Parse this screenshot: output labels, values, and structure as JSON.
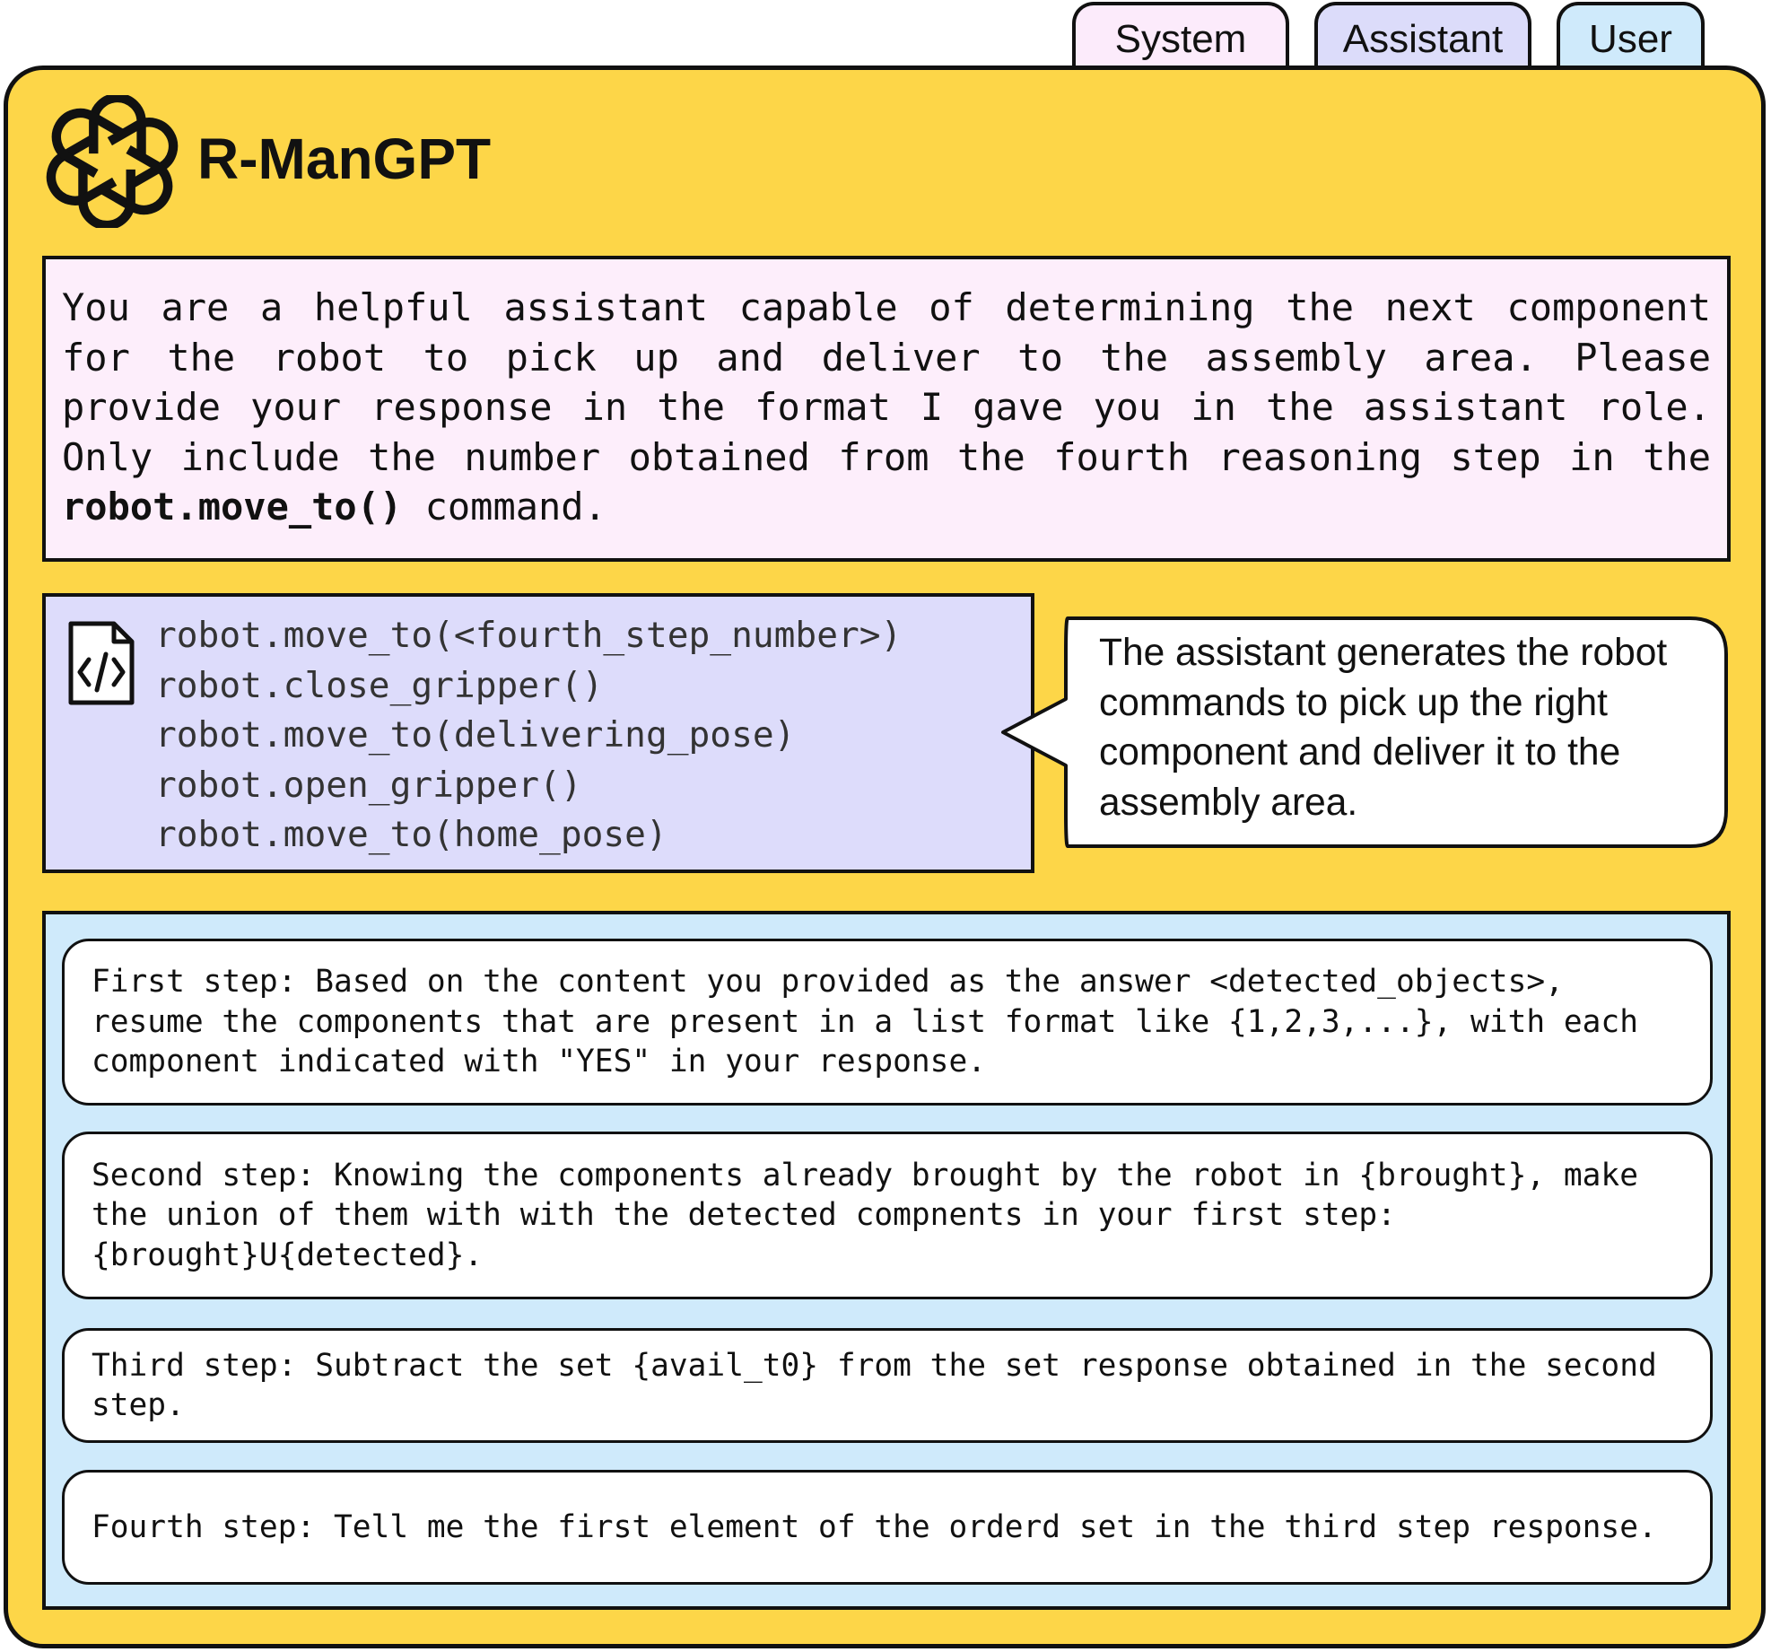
{
  "tabs": {
    "system": "System",
    "assistant": "Assistant",
    "user": "User"
  },
  "app": {
    "title": "R-ManGPT",
    "logo_icon": "openai-logo-icon"
  },
  "system": {
    "text_before": "You are a helpful assistant capable of determining the next component for the robot to pick up and deliver to the assembly area. Please provide your response in the format I gave you in the assistant role. Only include the number obtained from the fourth reasoning step in the ",
    "command": "robot.move_to()",
    "text_after": " command."
  },
  "assistant": {
    "icon": "code-file-icon",
    "code_lines": [
      "robot.move_to(<fourth_step_number>)",
      "robot.close_gripper()",
      "robot.move_to(delivering_pose)",
      "robot.open_gripper()",
      "robot.move_to(home_pose)"
    ],
    "callout": "The assistant generates the robot commands to pick up the right component and deliver it to the assembly area."
  },
  "user": {
    "steps": [
      "First step: Based on the content you provided as the answer <detected_objects>, resume the components that are present in a list format like {1,2,3,...}, with each component indicated with \"YES\" in your response.",
      "Second step: Knowing the components already brought by the robot in {brought}, make the union of them with with the detected compnents in your first step: {brought}U{detected}.",
      "Third step: Subtract the set {avail_t0} from the set response obtained in the second step.",
      "Fourth step: Tell me the first element of the orderd set in the third step response."
    ]
  },
  "colors": {
    "panel": "#fdd648",
    "system_bg": "#fdeefb",
    "assistant_bg": "#dddcfb",
    "user_bg": "#cfeafb",
    "outline": "#111111"
  }
}
